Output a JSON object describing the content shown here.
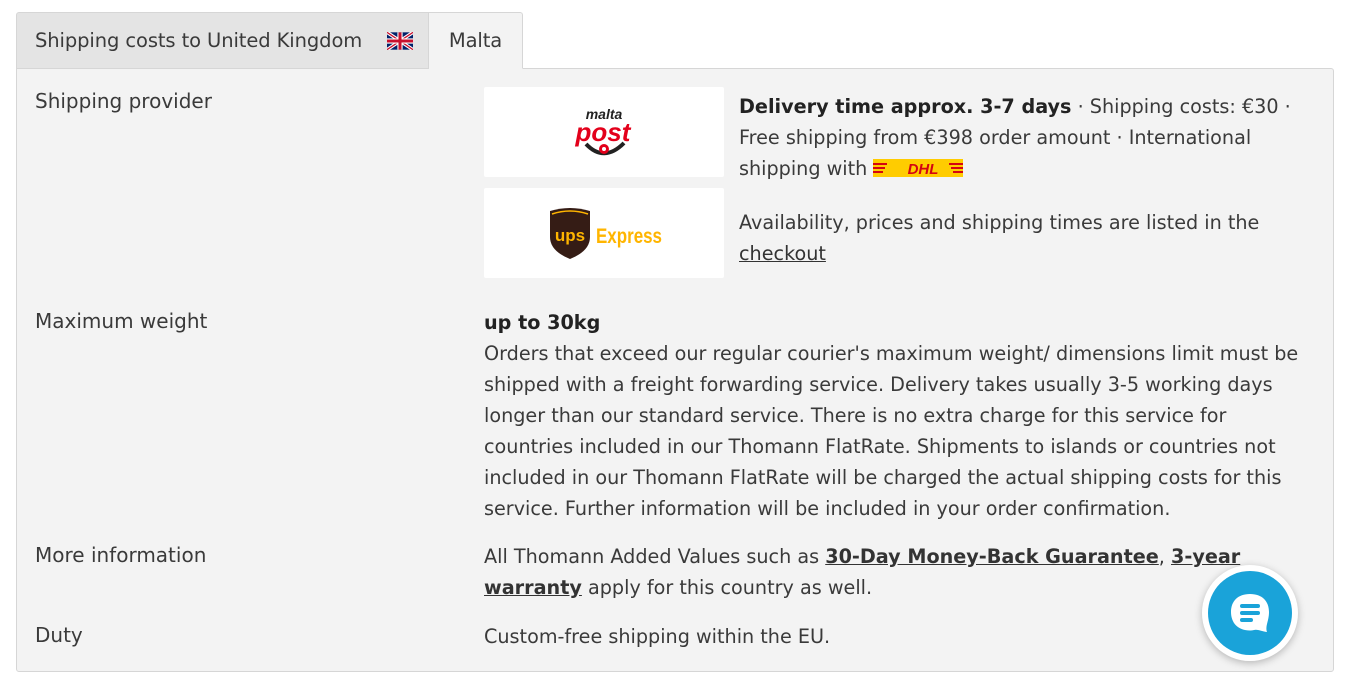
{
  "tabs": {
    "uk": {
      "label": "Shipping costs to United Kingdom",
      "flag_icon": "uk-flag-icon"
    },
    "malta": {
      "label": "Malta"
    }
  },
  "rows": {
    "provider": {
      "label": "Shipping provider",
      "logos": {
        "malta_post": {
          "line1": "malta",
          "line2": "post"
        },
        "ups": {
          "badge": "ups",
          "text": "Express"
        }
      },
      "delivery_bold": "Delivery time approx. 3-7 days",
      "delivery_rest": " · Shipping costs: €30 · Free shipping from €398 order amount · International shipping with ",
      "dhl_logo_text": "DHL",
      "availability_text": "Availability, prices and shipping times are listed in the ",
      "checkout_link": "checkout"
    },
    "weight": {
      "label": "Maximum weight",
      "value_bold": "up to 30kg",
      "description": "Orders that exceed our regular courier's maximum weight/ dimensions limit must be shipped with a freight forwarding service. Delivery takes usually 3-5 working days longer than our standard service. There is no extra charge for this service for countries included in our Thomann FlatRate. Shipments to islands or countries not included in our Thomann FlatRate will be charged the actual shipping costs for this service. Further information will be included in your order confirmation."
    },
    "info": {
      "label": "More information",
      "text_before": "All Thomann Added Values such as ",
      "link1": "30-Day Money-Back Guarantee",
      "sep": ", ",
      "link2": "3-year warranty",
      "text_after": " apply for this country as well."
    },
    "duty": {
      "label": "Duty",
      "value": "Custom-free shipping within the EU."
    }
  },
  "chat": {
    "icon": "chat-bubble-icon"
  },
  "colors": {
    "panel_bg": "#f3f3f3",
    "tab_inactive_bg": "#e4e4e4",
    "chat_blue": "#1aa3d9",
    "malta_post_red": "#e3001b",
    "ups_brown": "#351c15",
    "ups_gold": "#ffb500",
    "dhl_yellow": "#ffcc00",
    "dhl_red": "#d40511"
  }
}
